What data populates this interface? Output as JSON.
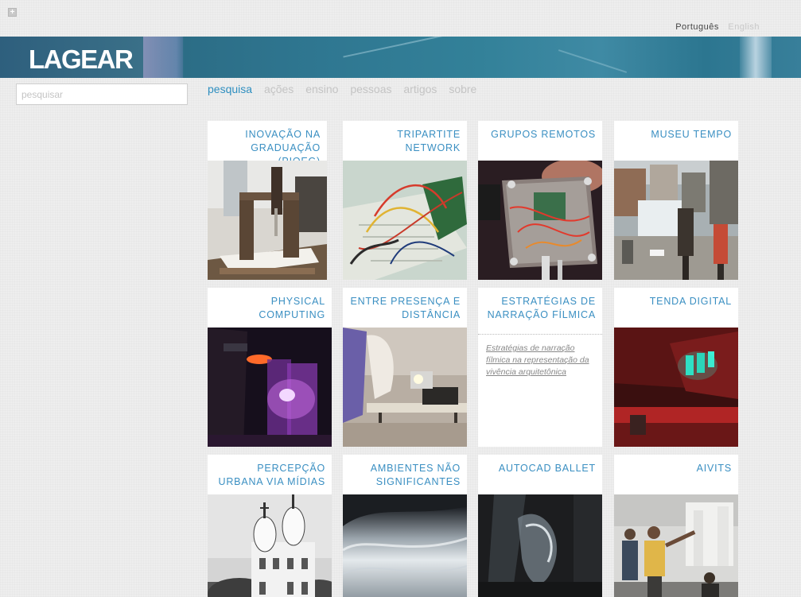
{
  "header": {
    "logo": "LAGEAR",
    "languages": [
      {
        "label": "Português",
        "active": true
      },
      {
        "label": "English",
        "active": false
      }
    ]
  },
  "search": {
    "placeholder": "pesquisar"
  },
  "nav": {
    "items": [
      "pesquisa",
      "ações",
      "ensino",
      "pessoas",
      "artigos",
      "sobre"
    ],
    "current": "pesquisa"
  },
  "colors": {
    "accent": "#3a8fc2",
    "nav_inactive": "#c4c4c4",
    "banner": "#2f7791"
  },
  "projects": [
    {
      "title": "INOVAÇÃO NA GRADUAÇÃO (PIQEG)",
      "image": "laser-cut-machine-photo"
    },
    {
      "title": "TRIPARTITE NETWORK",
      "image": "breadboard-arduino-photo"
    },
    {
      "title": "GRUPOS REMOTOS",
      "image": "acrylic-circuit-box-photo"
    },
    {
      "title": "MUSEU TEMPO",
      "image": "favela-street-photo"
    },
    {
      "title": "PHYSICAL COMPUTING",
      "image": "purple-glass-light-photo"
    },
    {
      "title": "ENTRE PRESENÇA E DISTÂNCIA",
      "image": "projector-table-photo"
    },
    {
      "title": "ESTRATÉGIAS DE NARRAÇÃO FÍLMICA",
      "text": "Estratégias de narração fílmica na representação da vivência arquitetônica"
    },
    {
      "title": "TENDA DIGITAL",
      "image": "red-tent-projection-photo"
    },
    {
      "title": "PERCEPÇÃO URBANA VIA MÍDIAS",
      "image": "baroque-church-photo"
    },
    {
      "title": "AMBIENTES NÃO SIGNIFICANTES",
      "image": "white-fabric-photo"
    },
    {
      "title": "AUTOCAD BALLET",
      "image": "dark-abstract-photo"
    },
    {
      "title": "AIVITS",
      "image": "people-gallery-photo"
    }
  ]
}
